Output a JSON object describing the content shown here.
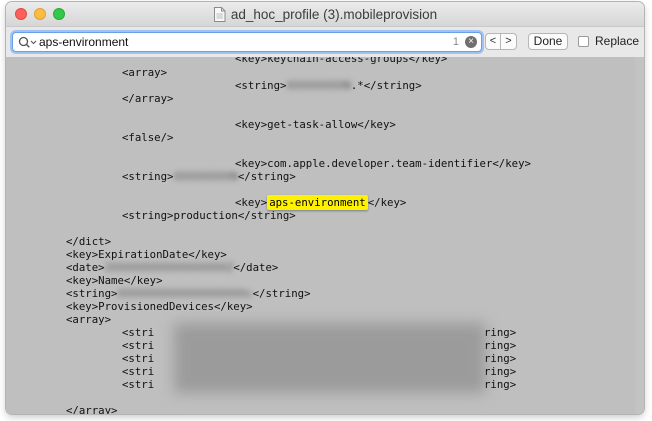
{
  "window": {
    "title": "ad_hoc_profile (3).mobileprovision"
  },
  "findbar": {
    "search_value": "aps-environment",
    "match_count": "1",
    "prev_label": "<",
    "next_label": ">",
    "done_label": "Done",
    "replace_label": "Replace",
    "replace_checked": false
  },
  "code": {
    "l01": "<key>keychain-access-groups</key>",
    "l02": "<array>",
    "l03a": "<string>",
    "l03b": "XXXXXXXXXN",
    "l03c": ".*</string>",
    "l04": "</array>",
    "l05": "<key>get-task-allow</key>",
    "l06": "<false/>",
    "l07": "<key>com.apple.developer.team-identifier</key>",
    "l08a": "<string>",
    "l08b": "XXXXXXXXXN",
    "l08c": "</string>",
    "l09a": "<key>",
    "l09hl": "aps-environment",
    "l09c": "</key>",
    "l10": "<string>production</string>",
    "l11": "</dict>",
    "l12": "<key>ExpirationDate</key>",
    "l13a": "<date>",
    "l13b": "2XXXXXXXXXXXXXXXXXXZ",
    "l13c": "</date>",
    "l14": "<key>Name</key>",
    "l15a": "<string>",
    "l15b": "XXXXXXXXXXXXXXXXXXXXc",
    "l15c": "</string>",
    "l16": "<key>ProvisionedDevices</key>",
    "l17": "<array>",
    "dev_start": "<stri",
    "dev_end": "ring>",
    "l23": "</array>"
  }
}
